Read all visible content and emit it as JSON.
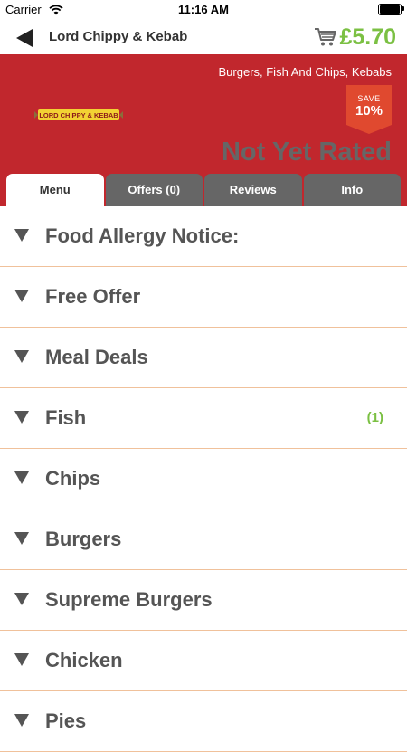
{
  "status_bar": {
    "carrier": "Carrier",
    "time": "11:16 AM"
  },
  "nav": {
    "title": "Lord Chippy & Kebab",
    "cart_total": "£5.70"
  },
  "restaurant": {
    "cuisines": "Burgers, Fish And Chips, Kebabs",
    "logo_text": "LORD CHIPPY & KEBAB",
    "save_label": "SAVE",
    "save_value": "10%",
    "rating_text": "Not Yet Rated"
  },
  "tabs": [
    {
      "label": "Menu",
      "active": true
    },
    {
      "label": "Offers (0)",
      "active": false
    },
    {
      "label": "Reviews",
      "active": false
    },
    {
      "label": "Info",
      "active": false
    }
  ],
  "menu": [
    {
      "label": "Food Allergy Notice:",
      "count": ""
    },
    {
      "label": "Free Offer",
      "count": ""
    },
    {
      "label": "Meal Deals",
      "count": ""
    },
    {
      "label": "Fish",
      "count": "(1)"
    },
    {
      "label": "Chips",
      "count": ""
    },
    {
      "label": "Burgers",
      "count": ""
    },
    {
      "label": "Supreme Burgers",
      "count": ""
    },
    {
      "label": "Chicken",
      "count": ""
    },
    {
      "label": "Pies",
      "count": ""
    }
  ],
  "colors": {
    "brand_red": "#c1272d",
    "price_green": "#7bc043",
    "divider_orange": "#f0c19b",
    "save_badge": "#e0492f"
  },
  "icons": [
    "wifi-icon",
    "battery-icon",
    "back-arrow-icon",
    "cart-icon",
    "chevron-down-icon"
  ]
}
